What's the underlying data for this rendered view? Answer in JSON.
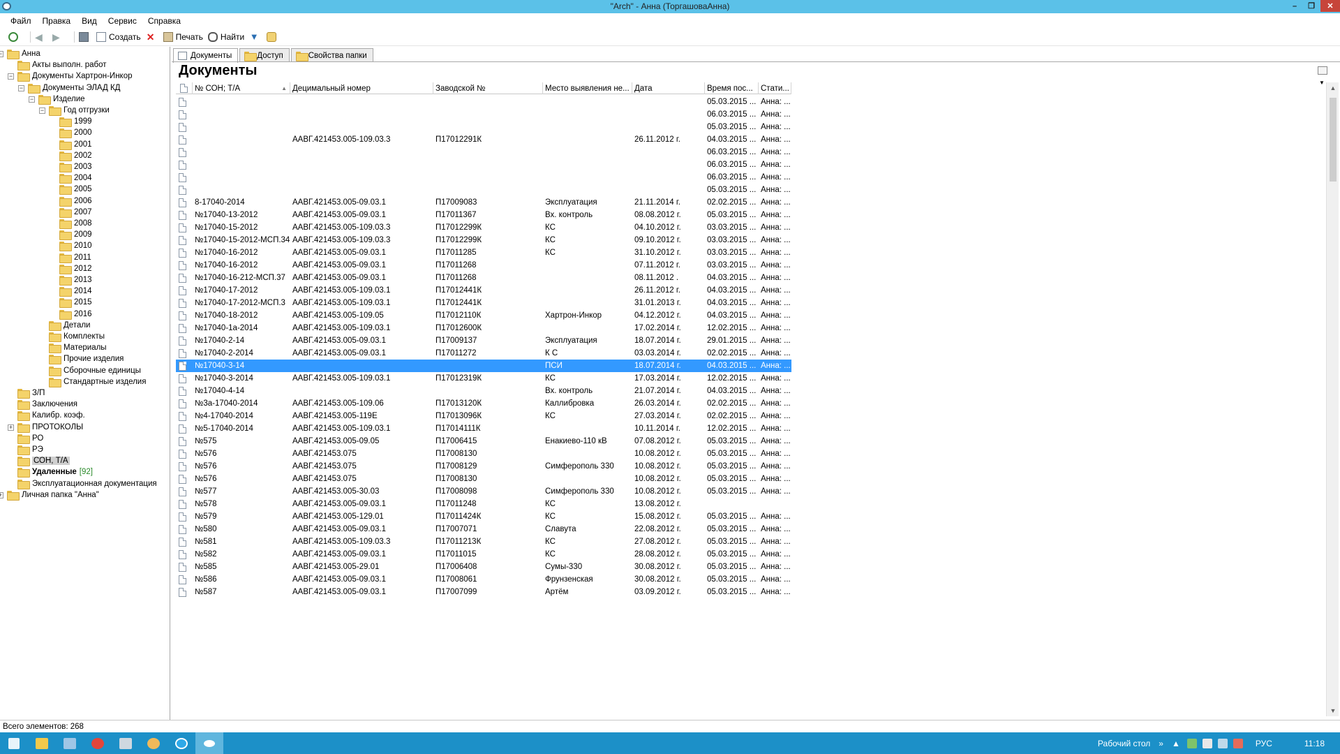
{
  "window": {
    "title": "\"Arch\" - Анна (ТоргашоваАнна)",
    "controls": [
      "minimize",
      "restore",
      "close"
    ]
  },
  "menu": [
    "Файл",
    "Правка",
    "Вид",
    "Сервис",
    "Справка"
  ],
  "toolbar": {
    "create_label": "Создать",
    "print_label": "Печать",
    "find_label": "Найти"
  },
  "tree": [
    {
      "label": "Анна",
      "level": 0,
      "expander": "-"
    },
    {
      "label": "Акты выполн. работ",
      "level": 1,
      "expander": ""
    },
    {
      "label": "Документы Хартрон-Инкор",
      "level": 1,
      "expander": "-"
    },
    {
      "label": "Документы ЭЛАД КД",
      "level": 2,
      "expander": "-"
    },
    {
      "label": "Изделие",
      "level": 3,
      "expander": "-"
    },
    {
      "label": "Год отгрузки",
      "level": 4,
      "expander": "-"
    },
    {
      "label": "1999",
      "level": 5,
      "expander": ""
    },
    {
      "label": "2000",
      "level": 5,
      "expander": ""
    },
    {
      "label": "2001",
      "level": 5,
      "expander": ""
    },
    {
      "label": "2002",
      "level": 5,
      "expander": ""
    },
    {
      "label": "2003",
      "level": 5,
      "expander": ""
    },
    {
      "label": "2004",
      "level": 5,
      "expander": ""
    },
    {
      "label": "2005",
      "level": 5,
      "expander": ""
    },
    {
      "label": "2006",
      "level": 5,
      "expander": ""
    },
    {
      "label": "2007",
      "level": 5,
      "expander": ""
    },
    {
      "label": "2008",
      "level": 5,
      "expander": ""
    },
    {
      "label": "2009",
      "level": 5,
      "expander": ""
    },
    {
      "label": "2010",
      "level": 5,
      "expander": ""
    },
    {
      "label": "2011",
      "level": 5,
      "expander": ""
    },
    {
      "label": "2012",
      "level": 5,
      "expander": ""
    },
    {
      "label": "2013",
      "level": 5,
      "expander": ""
    },
    {
      "label": "2014",
      "level": 5,
      "expander": ""
    },
    {
      "label": "2015",
      "level": 5,
      "expander": ""
    },
    {
      "label": "2016",
      "level": 5,
      "expander": ""
    },
    {
      "label": "Детали",
      "level": 4,
      "expander": ""
    },
    {
      "label": "Комплекты",
      "level": 4,
      "expander": ""
    },
    {
      "label": "Материалы",
      "level": 4,
      "expander": ""
    },
    {
      "label": "Прочие изделия",
      "level": 4,
      "expander": ""
    },
    {
      "label": "Сборочные единицы",
      "level": 4,
      "expander": ""
    },
    {
      "label": "Стандартные изделия",
      "level": 4,
      "expander": ""
    },
    {
      "label": "З/П",
      "level": 1,
      "expander": ""
    },
    {
      "label": "Заключения",
      "level": 1,
      "expander": ""
    },
    {
      "label": "Калибр. коэф.",
      "level": 1,
      "expander": ""
    },
    {
      "label": "ПРОТОКОЛЫ",
      "level": 1,
      "expander": "+"
    },
    {
      "label": "РО",
      "level": 1,
      "expander": ""
    },
    {
      "label": "РЭ",
      "level": 1,
      "expander": ""
    },
    {
      "label": "СОН, Т/А",
      "level": 1,
      "expander": "",
      "selected": true
    },
    {
      "label": "Удаленные",
      "level": 1,
      "expander": "",
      "bold": true,
      "count": "[92]"
    },
    {
      "label": "Эксплуатационная документация",
      "level": 1,
      "expander": ""
    },
    {
      "label": "Личная папка \"Анна\"",
      "level": 0,
      "expander": "+"
    }
  ],
  "tabs": [
    "Документы",
    "Доступ",
    "Свойства папки"
  ],
  "page_title": "Документы",
  "columns": [
    "№ СОН; Т/А",
    "Децимальный номер",
    "Заводской №",
    "Место выявления не...",
    "Дата",
    "Время пос...",
    "Стати..."
  ],
  "rows": [
    [
      "",
      "",
      "",
      "",
      "",
      "05.03.2015 ...",
      "Анна: ..."
    ],
    [
      "",
      "",
      "",
      "",
      "",
      "06.03.2015 ...",
      "Анна: ..."
    ],
    [
      "",
      "",
      "",
      "",
      "",
      "05.03.2015 ...",
      "Анна: ..."
    ],
    [
      "",
      "ААВГ.421453.005-109.03.3",
      "П17012291К",
      "",
      "26.11.2012 г.",
      "04.03.2015 ...",
      "Анна: ..."
    ],
    [
      "",
      "",
      "",
      "",
      "",
      "06.03.2015 ...",
      "Анна: ..."
    ],
    [
      "",
      "",
      "",
      "",
      "",
      "06.03.2015 ...",
      "Анна: ..."
    ],
    [
      "",
      "",
      "",
      "",
      "",
      "06.03.2015 ...",
      "Анна: ..."
    ],
    [
      "",
      "",
      "",
      "",
      "",
      "05.03.2015 ...",
      "Анна: ..."
    ],
    [
      "8-17040-2014",
      "ААВГ.421453.005-09.03.1",
      "П17009083",
      "Эксплуатация",
      "21.11.2014 г.",
      "02.02.2015 ...",
      "Анна: ..."
    ],
    [
      "№17040-13-2012",
      "ААВГ.421453.005-09.03.1",
      "П17011367",
      "Вх. контроль",
      "08.08.2012 г.",
      "05.03.2015 ...",
      "Анна: ..."
    ],
    [
      "№17040-15-2012",
      "ААВГ.421453.005-109.03.3",
      "П17012299К",
      "КС",
      "04.10.2012 г.",
      "03.03.2015 ...",
      "Анна: ..."
    ],
    [
      "№17040-15-2012-МСП.34",
      "ААВГ.421453.005-109.03.3",
      "П17012299К",
      "КС",
      "09.10.2012 г.",
      "03.03.2015 ...",
      "Анна: ..."
    ],
    [
      "№17040-16-2012",
      "ААВГ.421453.005-09.03.1",
      "П17011285",
      "КС",
      "31.10.2012 г.",
      "03.03.2015 ...",
      "Анна: ..."
    ],
    [
      "№17040-16-2012",
      "ААВГ.421453.005-09.03.1",
      "П17011268",
      "",
      "07.11.2012 г.",
      "03.03.2015 ...",
      "Анна: ..."
    ],
    [
      "№17040-16-212-МСП.37",
      "ААВГ.421453.005-09.03.1",
      "П17011268",
      "",
      "08.11.2012 .",
      "04.03.2015 ...",
      "Анна: ..."
    ],
    [
      "№17040-17-2012",
      "ААВГ.421453.005-109.03.1",
      "П17012441К",
      "",
      "26.11.2012 г.",
      "04.03.2015 ...",
      "Анна: ..."
    ],
    [
      "№17040-17-2012-МСП.3",
      "ААВГ.421453.005-109.03.1",
      "П17012441К",
      "",
      "31.01.2013 г.",
      "04.03.2015 ...",
      "Анна: ..."
    ],
    [
      "№17040-18-2012",
      "ААВГ.421453.005-109.05",
      "П17012110К",
      "Хартрон-Инкор",
      "04.12.2012 г.",
      "04.03.2015 ...",
      "Анна: ..."
    ],
    [
      "№17040-1а-2014",
      "ААВГ.421453.005-109.03.1",
      "П17012600К",
      "",
      "17.02.2014 г.",
      "12.02.2015 ...",
      "Анна: ..."
    ],
    [
      "№17040-2-14",
      "ААВГ.421453.005-09.03.1",
      "П17009137",
      "Эксплуатация",
      "18.07.2014 г.",
      "29.01.2015 ...",
      "Анна: ..."
    ],
    [
      "№17040-2-2014",
      "ААВГ.421453.005-09.03.1",
      "П17011272",
      "К С",
      "03.03.2014 г.",
      "02.02.2015 ...",
      "Анна: ..."
    ],
    [
      "№17040-3-14",
      "",
      "",
      "ПСИ",
      "18.07.2014 г.",
      "04.03.2015 ...",
      "Анна: ..."
    ],
    [
      "№17040-3-2014",
      "ААВГ.421453.005-109.03.1",
      "П17012319К",
      "КС",
      "17.03.2014 г.",
      "12.02.2015 ...",
      "Анна: ..."
    ],
    [
      "№17040-4-14",
      "",
      "",
      "Вх. контроль",
      "21.07.2014 г.",
      "04.03.2015 ...",
      "Анна: ..."
    ],
    [
      "№3а-17040-2014",
      "ААВГ.421453.005-109.06",
      "П17013120К",
      "Каллибровка",
      "26.03.2014 г.",
      "02.02.2015 ...",
      "Анна: ..."
    ],
    [
      "№4-17040-2014",
      "ААВГ.421453.005-119Е",
      "П17013096К",
      "КС",
      "27.03.2014 г.",
      "02.02.2015 ...",
      "Анна: ..."
    ],
    [
      "№5-17040-2014",
      "ААВГ.421453.005-109.03.1",
      "П17014111К",
      "",
      "10.11.2014 г.",
      "12.02.2015 ...",
      "Анна: ..."
    ],
    [
      "№575",
      "ААВГ.421453.005-09.05",
      "П17006415",
      "Енакиево-110 кВ",
      "07.08.2012 г.",
      "05.03.2015 ...",
      "Анна: ..."
    ],
    [
      "№576",
      "ААВГ.421453.075",
      "П17008130",
      "",
      "10.08.2012 г.",
      "05.03.2015 ...",
      "Анна: ..."
    ],
    [
      "№576",
      "ААВГ.421453.075",
      "П17008129",
      "Симферополь 330",
      "10.08.2012 г.",
      "05.03.2015 ...",
      "Анна: ..."
    ],
    [
      "№576",
      "ААВГ.421453.075",
      "П17008130",
      "",
      "10.08.2012 г.",
      "05.03.2015 ...",
      "Анна: ..."
    ],
    [
      "№577",
      "ААВГ.421453.005-30.03",
      "П17008098",
      "Симферополь 330",
      "10.08.2012 г.",
      "05.03.2015 ...",
      "Анна: ..."
    ],
    [
      "№578",
      "ААВГ.421453.005-09.03.1",
      "П17011248",
      "КС",
      "13.08.2012 г.",
      "",
      ""
    ],
    [
      "№579",
      "ААВГ.421453.005-129.01",
      "П17011424К",
      "КС",
      "15.08.2012 г.",
      "05.03.2015 ...",
      "Анна: ..."
    ],
    [
      "№580",
      "ААВГ.421453.005-09.03.1",
      "П17007071",
      "Славута",
      "22.08.2012 г.",
      "05.03.2015 ...",
      "Анна: ..."
    ],
    [
      "№581",
      "ААВГ.421453.005-109.03.3",
      "П17011213К",
      "КС",
      "27.08.2012 г.",
      "05.03.2015 ...",
      "Анна: ..."
    ],
    [
      "№582",
      "ААВГ.421453.005-09.03.1",
      "П17011015",
      "КС",
      "28.08.2012 г.",
      "05.03.2015 ...",
      "Анна: ..."
    ],
    [
      "№585",
      "ААВГ.421453.005-29.01",
      "П17006408",
      "Сумы-330",
      "30.08.2012 г.",
      "05.03.2015 ...",
      "Анна: ..."
    ],
    [
      "№586",
      "ААВГ.421453.005-09.03.1",
      "П17008061",
      "Фрунзенская",
      "30.08.2012 г.",
      "05.03.2015 ...",
      "Анна: ..."
    ],
    [
      "№587",
      "ААВГ.421453.005-09.03.1",
      "П17007099",
      "Артём",
      "03.09.2012 г.",
      "05.03.2015 ...",
      "Анна: ..."
    ]
  ],
  "selected_row_index": 21,
  "status": "Всего элементов: 268",
  "taskbar": {
    "desktop_label": "Рабочий стол",
    "lang": "РУС",
    "time": "11:18"
  },
  "colors": {
    "titlebar": "#5bc1e8",
    "selection": "#3399ff",
    "taskbar": "#1c90c8"
  }
}
